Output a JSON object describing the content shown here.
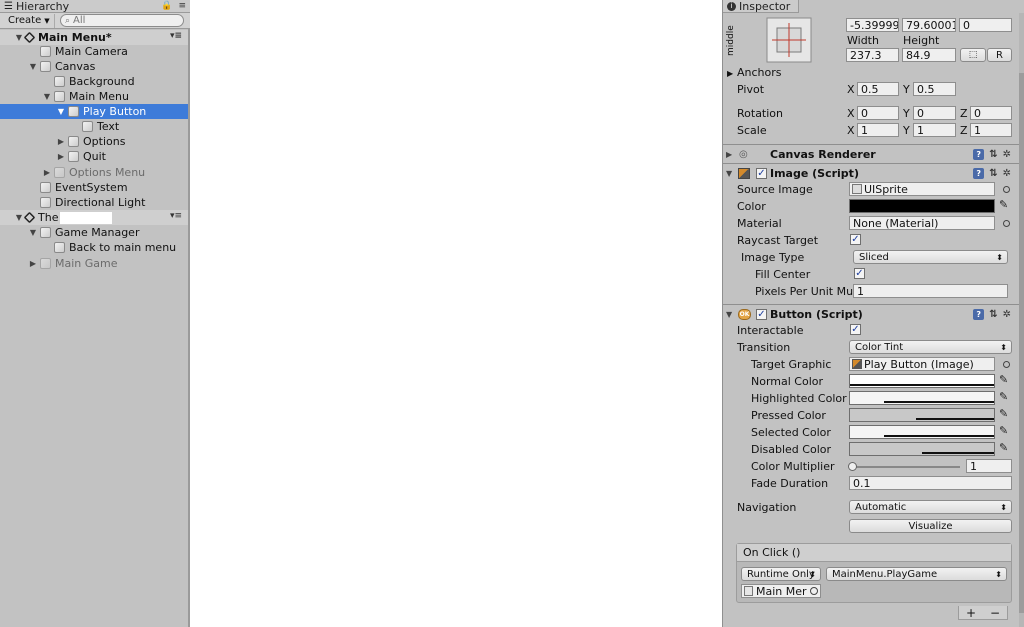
{
  "hierarchy": {
    "tab_title": "Hierarchy",
    "create_label": "Create",
    "search_placeholder": "All",
    "rows": [
      {
        "label": "Main Menu*"
      },
      {
        "label": "Main Camera"
      },
      {
        "label": "Canvas"
      },
      {
        "label": "Background"
      },
      {
        "label": "Main Menu"
      },
      {
        "label": "Play Button"
      },
      {
        "label": "Text"
      },
      {
        "label": "Options"
      },
      {
        "label": "Quit"
      },
      {
        "label": "Options Menu"
      },
      {
        "label": "EventSystem"
      },
      {
        "label": "Directional Light"
      },
      {
        "label": "The"
      },
      {
        "label": "Game Manager"
      },
      {
        "label": "Back to main menu"
      },
      {
        "label": "Main Game"
      }
    ]
  },
  "inspector": {
    "tab_title": "Inspector",
    "rect_transform": {
      "anchor_preset_label": "middle",
      "pos_x": "-5.39999",
      "pos_y": "79.60001",
      "pos_z": "0",
      "width_label": "Width",
      "height_label": "Height",
      "width": "237.3",
      "height": "84.9",
      "r_button": "R",
      "anchors_label": "Anchors",
      "pivot_label": "Pivot",
      "pivot_x": "0.5",
      "pivot_y": "0.5",
      "rotation_label": "Rotation",
      "rot_x": "0",
      "rot_y": "0",
      "rot_z": "0",
      "scale_label": "Scale",
      "scale_x": "1",
      "scale_y": "1",
      "scale_z": "1",
      "axis_x": "X",
      "axis_y": "Y",
      "axis_z": "Z"
    },
    "canvas_renderer": {
      "title": "Canvas Renderer"
    },
    "image": {
      "title": "Image (Script)",
      "source_image_label": "Source Image",
      "source_image_value": "UISprite",
      "color_label": "Color",
      "material_label": "Material",
      "material_value": "None (Material)",
      "raycast_label": "Raycast Target",
      "image_type_label": "Image Type",
      "image_type_value": "Sliced",
      "fill_center_label": "Fill Center",
      "ppu_label": "Pixels Per Unit Mul",
      "ppu_value": "1"
    },
    "button": {
      "title": "Button (Script)",
      "icon_text": "OK",
      "interactable_label": "Interactable",
      "transition_label": "Transition",
      "transition_value": "Color Tint",
      "target_graphic_label": "Target Graphic",
      "target_graphic_value": "Play Button (Image)",
      "normal_color_label": "Normal Color",
      "highlighted_color_label": "Highlighted Color",
      "pressed_color_label": "Pressed Color",
      "selected_color_label": "Selected Color",
      "disabled_color_label": "Disabled Color",
      "color_multiplier_label": "Color Multiplier",
      "color_multiplier_value": "1",
      "fade_duration_label": "Fade Duration",
      "fade_duration_value": "0.1",
      "navigation_label": "Navigation",
      "navigation_value": "Automatic",
      "visualize_label": "Visualize",
      "on_click_label": "On Click ()",
      "runtime_value": "Runtime Only",
      "function_value": "MainMenu.PlayGame",
      "object_value": "Main Mer",
      "plus": "+",
      "minus": "−"
    },
    "colors": {
      "image_color": "#000000",
      "normal": "#ffffff",
      "highlighted": "#f5f5f5",
      "pressed": "#c8c8c8",
      "selected": "#f5f5f5",
      "disabled": "#c8c8c8"
    }
  },
  "colors": {
    "panel_bg": "#c2c2c2",
    "selection": "#3d7bd9",
    "viewport": "#ffffff"
  }
}
